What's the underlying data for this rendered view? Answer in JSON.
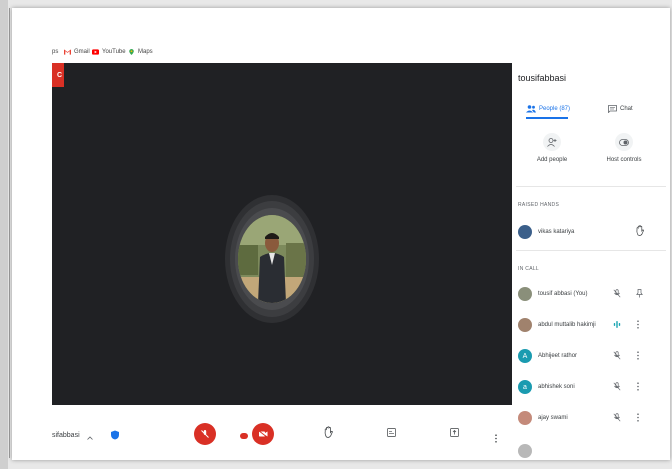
{
  "bookmarks": [
    {
      "label": "ps",
      "icon": "apps-icon",
      "color": "#666666"
    },
    {
      "label": "Gmail",
      "icon": "gmail-icon",
      "color": "#ea4335"
    },
    {
      "label": "YouTube",
      "icon": "youtube-icon",
      "color": "#ff0000"
    },
    {
      "label": "Maps",
      "icon": "maps-icon",
      "color": "#34a853"
    }
  ],
  "recording_badge": "C",
  "sidebar": {
    "title": "tousifabbasi",
    "tabs": {
      "people": "People (87)",
      "chat": "Chat"
    },
    "actions": {
      "add_people": "Add people",
      "host_controls": "Host controls"
    },
    "raised_hands_header": "RAISED HANDS",
    "raised_hands": [
      {
        "name": "vikas katariya",
        "icon": "hand-icon"
      }
    ],
    "in_call_header": "IN CALL",
    "in_call": [
      {
        "name": "tousif abbasi (You)",
        "avatar_color": "#8a8f7a",
        "letter": "",
        "mic": "mic-off-icon",
        "action": "pin-icon"
      },
      {
        "name": "abdul muttalib hakimji",
        "avatar_color": "#a0826d",
        "letter": "",
        "mic": "audio-active-icon",
        "action": "more-vert-icon"
      },
      {
        "name": "Abhijeet rathor",
        "avatar_color": "#12a4af",
        "letter": "A",
        "mic": "mic-off-icon",
        "action": "more-vert-icon"
      },
      {
        "name": "abhishek soni",
        "avatar_color": "#12a4af",
        "letter": "a",
        "mic": "mic-off-icon",
        "action": "more-vert-icon"
      },
      {
        "name": "ajay swami",
        "avatar_color": "#c48a7a",
        "letter": "",
        "mic": "mic-off-icon",
        "action": "more-vert-icon"
      }
    ]
  },
  "controls": {
    "meeting_name": "sifabbasi"
  },
  "colors": {
    "accent": "#1a73e8",
    "danger": "#d93025",
    "video_bg": "#202124"
  }
}
